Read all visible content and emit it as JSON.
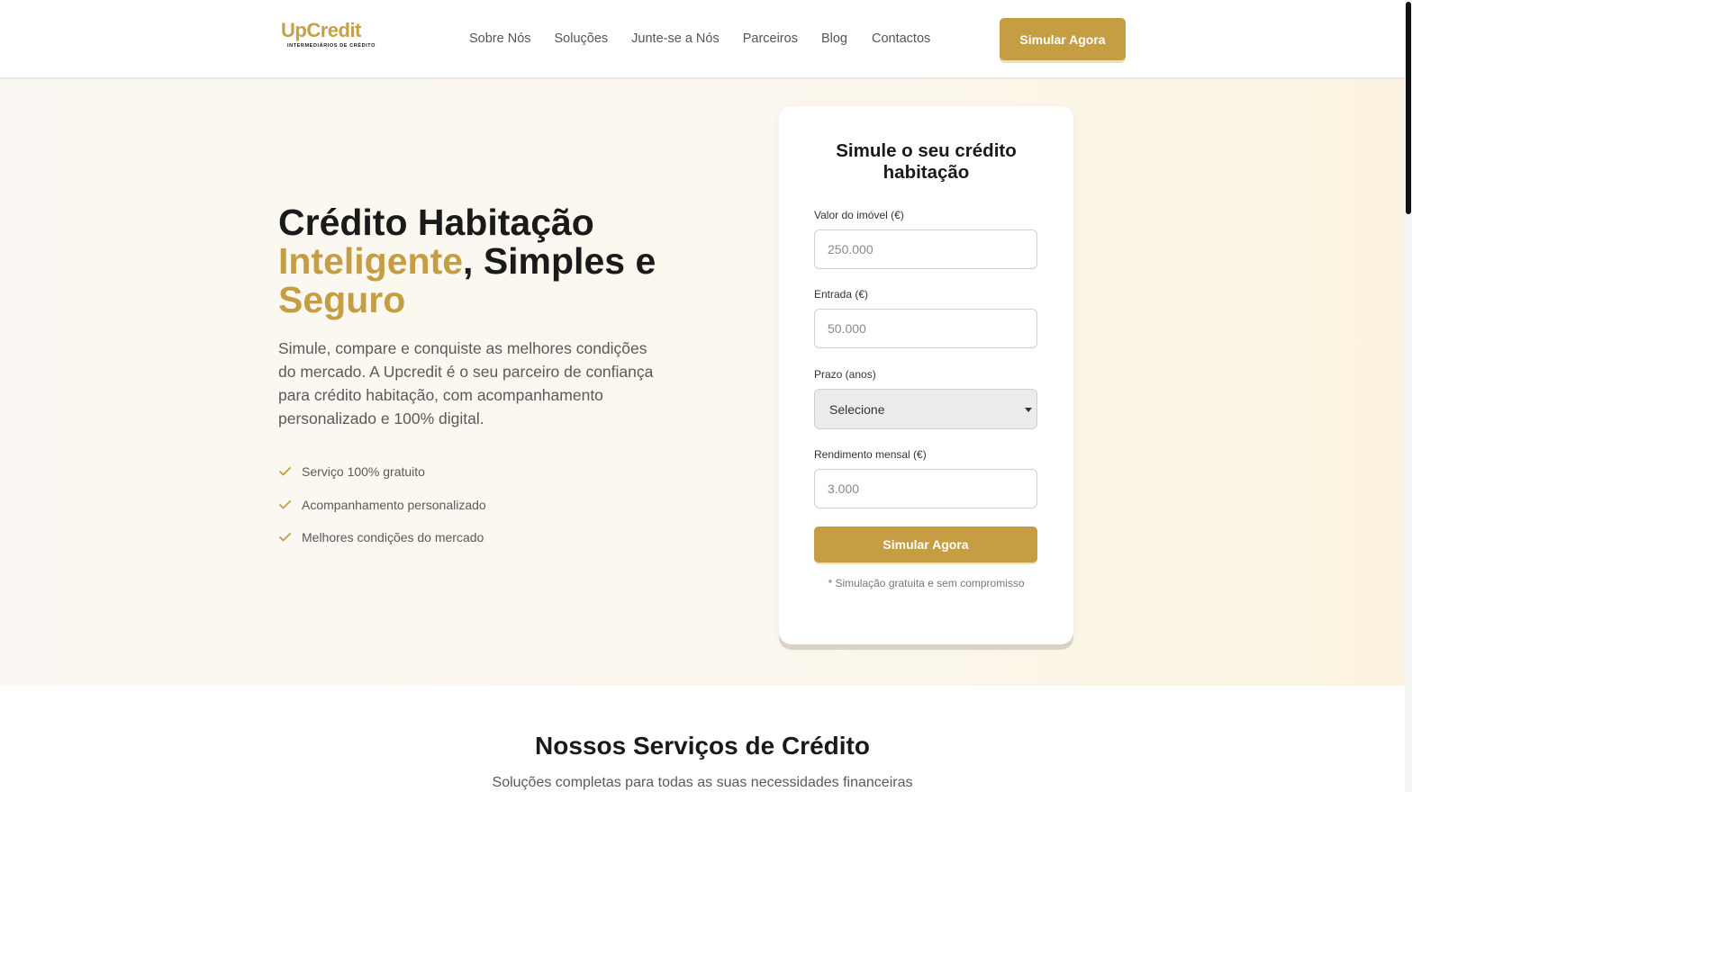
{
  "brand": {
    "logo_text": "UpCredit",
    "logo_tagline": "INTERMEDIÁRIOS DE CRÉDITO",
    "accent_color": "#c59d42"
  },
  "nav": {
    "items": [
      {
        "label": "Sobre Nós"
      },
      {
        "label": "Soluções"
      },
      {
        "label": "Junte-se a Nós"
      },
      {
        "label": "Parceiros"
      },
      {
        "label": "Blog"
      },
      {
        "label": "Contactos"
      }
    ],
    "cta_label": "Simular Agora"
  },
  "hero": {
    "title_part1": "Crédito Habitação ",
    "title_highlight1": "Inteligente",
    "title_part2": ", Simples e ",
    "title_highlight2": "Seguro",
    "description": "Simule, compare e conquiste as melhores condições do mercado. A Upcredit é o seu parceiro de confiança para crédito habitação, com acompanhamento personalizado e 100% digital.",
    "features": [
      {
        "label": "Serviço 100% gratuito",
        "icon": "check-icon"
      },
      {
        "label": "Acompanhamento personalizado",
        "icon": "check-icon"
      },
      {
        "label": "Melhores condições do mercado",
        "icon": "check-icon"
      }
    ]
  },
  "simulator": {
    "title": "Simule o seu crédito habitação",
    "fields": {
      "property_value": {
        "label": "Valor do imóvel (€)",
        "placeholder": "250.000"
      },
      "down_payment": {
        "label": "Entrada (€)",
        "placeholder": "50.000"
      },
      "term": {
        "label": "Prazo (anos)",
        "selected": "Selecione"
      },
      "income": {
        "label": "Rendimento mensal (€)",
        "placeholder": "3.000"
      }
    },
    "submit_label": "Simular Agora",
    "note": "* Simulação gratuita e sem compromisso"
  },
  "services": {
    "title": "Nossos Serviços de Crédito",
    "subtitle": "Soluções completas para todas as suas necessidades financeiras"
  }
}
